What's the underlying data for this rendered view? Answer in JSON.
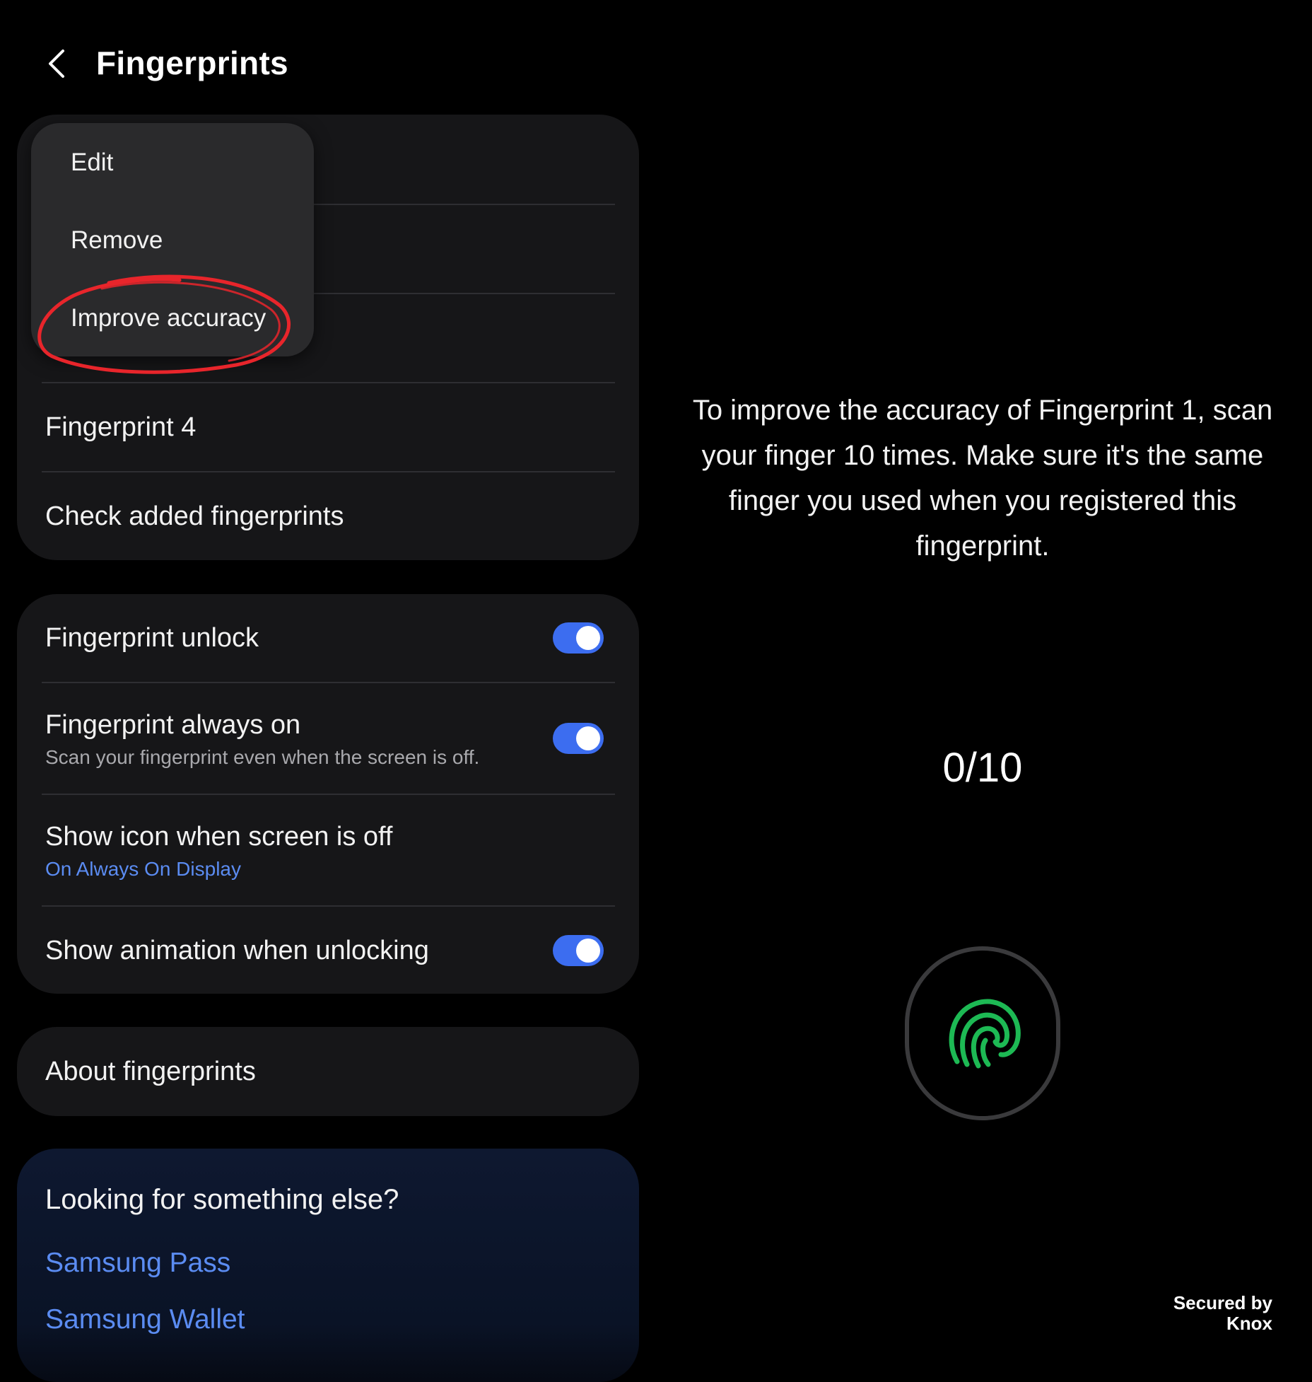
{
  "header": {
    "title": "Fingerprints",
    "back_icon": "chevron-left-icon"
  },
  "context_menu": {
    "items": [
      {
        "label": "Edit"
      },
      {
        "label": "Remove"
      },
      {
        "label": "Improve accuracy"
      }
    ],
    "annotation_color": "#e8252b"
  },
  "fingerprints_card": {
    "items": [
      {
        "label": "Fingerprint 4"
      },
      {
        "label": "Check added fingerprints"
      }
    ]
  },
  "settings_card": {
    "fingerprint_unlock": {
      "label": "Fingerprint unlock",
      "enabled": true
    },
    "fingerprint_always_on": {
      "label": "Fingerprint always on",
      "description": "Scan your fingerprint even when the screen is off.",
      "enabled": true
    },
    "show_icon": {
      "label": "Show icon when screen is off",
      "value": "On Always On Display"
    },
    "show_animation": {
      "label": "Show animation when unlocking",
      "enabled": true
    }
  },
  "about_card": {
    "label": "About fingerprints"
  },
  "looking_card": {
    "title": "Looking for something else?",
    "links": [
      {
        "label": "Samsung Pass"
      },
      {
        "label": "Samsung Wallet"
      }
    ]
  },
  "enrollment": {
    "instructions": "To improve the accuracy of Fingerprint 1, scan your finger 10 times. Make sure it's the same finger you used when you registered this fingerprint.",
    "progress": "0/10",
    "sensor_icon": "fingerprint-icon"
  },
  "footer": {
    "line1": "Secured by",
    "line2": "Knox"
  },
  "colors": {
    "background": "#000000",
    "card": "#161618",
    "accent_blue": "#3c6df0",
    "link_blue": "#5b8cf2",
    "fingerprint_green": "#1db954"
  }
}
